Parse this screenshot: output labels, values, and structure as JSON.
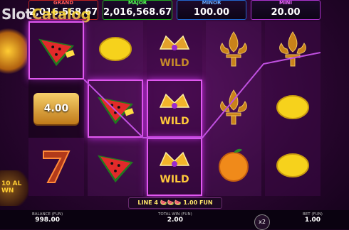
{
  "jackpots": {
    "grand": {
      "label": "GRAND",
      "value": "2,016,568.67"
    },
    "major": {
      "label": "MAJOR",
      "value": "2,016,568.67"
    },
    "minor": {
      "label": "MINOR",
      "value": "100.00"
    },
    "mini": {
      "label": "MINI",
      "value": "20.00"
    }
  },
  "watermark": {
    "part1": "Slot",
    "part2": "Catalog"
  },
  "side_bonus": {
    "text": "10 AL WN"
  },
  "reels": [
    [
      "watermelon",
      "gold-bar",
      "seven"
    ],
    [
      "lemon",
      "watermelon",
      "watermelon"
    ],
    [
      "crown-wild",
      "crown-wild",
      "crown-wild"
    ],
    [
      "fleur",
      "fleur",
      "orange"
    ],
    [
      "fleur",
      "lemon",
      "lemon"
    ]
  ],
  "symbols": {
    "wild_text": "WILD",
    "gold_bar_value": "4.00"
  },
  "win_line": {
    "text": "LINE 4 🍉🍉🍉 1.00 FUN"
  },
  "footer": {
    "balance_label": "BALANCE (FUN)",
    "balance_value": "998.00",
    "total_win_label": "TOTAL WIN (FUN)",
    "total_win_value": "2.00",
    "bet_label": "BET (FUN)",
    "bet_value": "1.00",
    "multiplier": "x2"
  },
  "colors": {
    "highlight": "#e058f0",
    "payline": "#c050e0"
  }
}
